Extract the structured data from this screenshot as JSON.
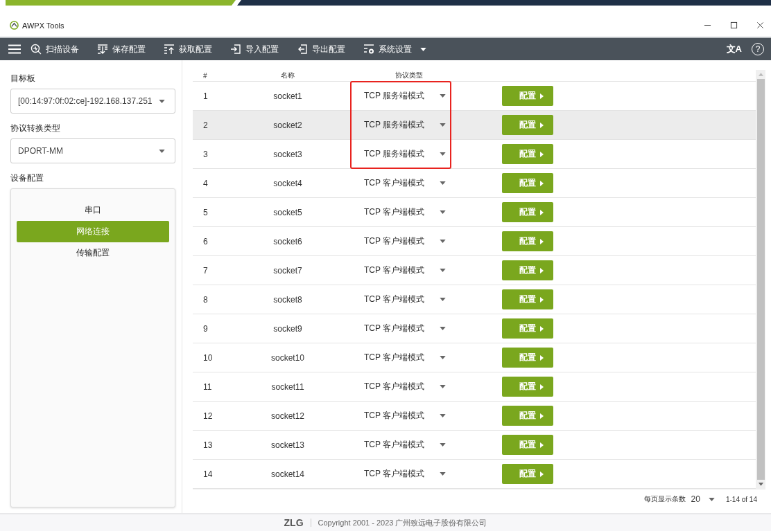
{
  "window": {
    "title": "AWPX Tools"
  },
  "toolbar": {
    "items": [
      {
        "label": "扫描设备"
      },
      {
        "label": "保存配置"
      },
      {
        "label": "获取配置"
      },
      {
        "label": "导入配置"
      },
      {
        "label": "导出配置"
      },
      {
        "label": "系统设置"
      }
    ],
    "language_glyph": "文A",
    "help_glyph": "?"
  },
  "sidebar": {
    "target_label": "目标板",
    "target_value": "[00:14:97:0f:02:ce]-192.168.137.251",
    "type_label": "协议转换类型",
    "type_value": "DPORT-MM",
    "config_label": "设备配置",
    "items": [
      {
        "label": "串口",
        "selected": false
      },
      {
        "label": "网络连接",
        "selected": true
      },
      {
        "label": "传输配置",
        "selected": false
      }
    ]
  },
  "table": {
    "columns": [
      "#",
      "名称",
      "协议类型"
    ],
    "rows": [
      {
        "index": "1",
        "name": "socket1",
        "protocol": "TCP 服务端模式",
        "button": "配置",
        "selected": false,
        "marked": true
      },
      {
        "index": "2",
        "name": "socket2",
        "protocol": "TCP 服务端模式",
        "button": "配置",
        "selected": true,
        "marked": true
      },
      {
        "index": "3",
        "name": "socket3",
        "protocol": "TCP 服务端模式",
        "button": "配置",
        "selected": false,
        "marked": true
      },
      {
        "index": "4",
        "name": "socket4",
        "protocol": "TCP 客户端模式",
        "button": "配置",
        "selected": false,
        "marked": false
      },
      {
        "index": "5",
        "name": "socket5",
        "protocol": "TCP 客户端模式",
        "button": "配置",
        "selected": false,
        "marked": false
      },
      {
        "index": "6",
        "name": "socket6",
        "protocol": "TCP 客户端模式",
        "button": "配置",
        "selected": false,
        "marked": false
      },
      {
        "index": "7",
        "name": "socket7",
        "protocol": "TCP 客户端模式",
        "button": "配置",
        "selected": false,
        "marked": false
      },
      {
        "index": "8",
        "name": "socket8",
        "protocol": "TCP 客户端模式",
        "button": "配置",
        "selected": false,
        "marked": false
      },
      {
        "index": "9",
        "name": "socket9",
        "protocol": "TCP 客户端模式",
        "button": "配置",
        "selected": false,
        "marked": false
      },
      {
        "index": "10",
        "name": "socket10",
        "protocol": "TCP 客户端模式",
        "button": "配置",
        "selected": false,
        "marked": false
      },
      {
        "index": "11",
        "name": "socket11",
        "protocol": "TCP 客户端模式",
        "button": "配置",
        "selected": false,
        "marked": false
      },
      {
        "index": "12",
        "name": "socket12",
        "protocol": "TCP 客户端模式",
        "button": "配置",
        "selected": false,
        "marked": false
      },
      {
        "index": "13",
        "name": "socket13",
        "protocol": "TCP 客户端模式",
        "button": "配置",
        "selected": false,
        "marked": false
      },
      {
        "index": "14",
        "name": "socket14",
        "protocol": "TCP 客户端模式",
        "button": "配置",
        "selected": false,
        "marked": false
      }
    ]
  },
  "pagination": {
    "label": "每页显示条数",
    "page_size": "20",
    "range": "1-14 of 14"
  },
  "footer": {
    "logo": "ZLG",
    "copyright": "Copyright 2001 - 2023 广州致远电子股份有限公司"
  }
}
